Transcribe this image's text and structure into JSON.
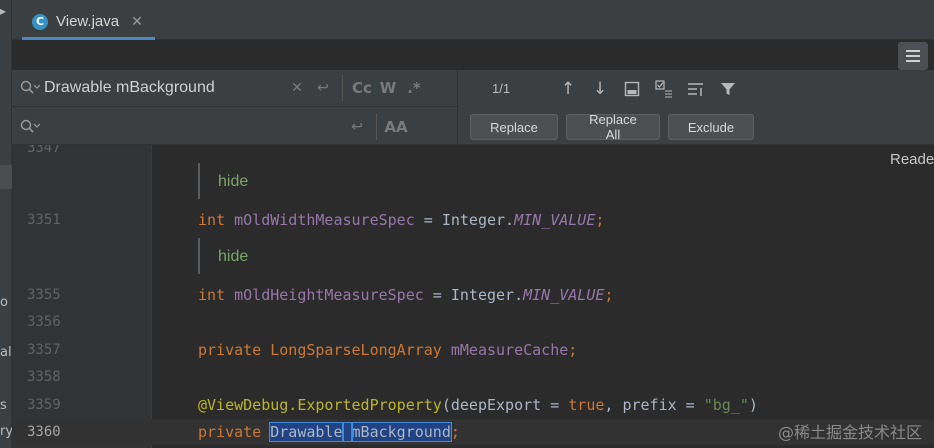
{
  "tab": {
    "title": "View.java",
    "icon_letter": "C",
    "close": "✕"
  },
  "left_strip_fragments": [
    "o",
    "al",
    "s",
    "ry"
  ],
  "find": {
    "query": "Drawable mBackground",
    "replace_value": "",
    "match_count": "1/1",
    "option_labels": {
      "match_case": "Cc",
      "words": "W",
      "regex": ".*",
      "preserve_case": "AA"
    }
  },
  "buttons": {
    "replace": "Replace",
    "replace_all": "Replace All",
    "exclude": "Exclude"
  },
  "reader_mode": "Reade",
  "watermark": "@稀土掘金技术社区",
  "editor": {
    "lines": [
      {
        "num": "3347"
      },
      {
        "doc": "hide"
      },
      {
        "num": "3351",
        "tokens": [
          [
            "int ",
            "kw"
          ],
          [
            "mOldWidthMeasureSpec",
            "fld"
          ],
          [
            " = Integer.",
            "plain"
          ],
          [
            "MIN_VALUE",
            "stat"
          ],
          [
            ";",
            "kw"
          ]
        ]
      },
      {
        "doc": "hide"
      },
      {
        "num": "3355",
        "tokens": [
          [
            "int ",
            "kw"
          ],
          [
            "mOldHeightMeasureSpec",
            "fld"
          ],
          [
            " = Integer.",
            "plain"
          ],
          [
            "MIN_VALUE",
            "stat"
          ],
          [
            ";",
            "kw"
          ]
        ]
      },
      {
        "num": "3356"
      },
      {
        "num": "3357",
        "tokens": [
          [
            "private ",
            "kw"
          ],
          [
            "LongSparseLongArray ",
            "kw"
          ],
          [
            "mMeasureCache",
            "fld"
          ],
          [
            ";",
            "kw"
          ]
        ]
      },
      {
        "num": "3358"
      },
      {
        "num": "3359",
        "tokens": [
          [
            "@ViewDebug.",
            "ann"
          ],
          [
            "ExportedProperty",
            "ann"
          ],
          [
            "(deepExport = ",
            "plain"
          ],
          [
            "true",
            "kw"
          ],
          [
            ", prefix = ",
            "plain"
          ],
          [
            "\"bg_\"",
            "str"
          ],
          [
            ")",
            "plain"
          ]
        ]
      },
      {
        "num": "3360",
        "tokens": [
          [
            "private ",
            "kw"
          ],
          [
            "Drawable",
            "sel"
          ],
          [
            " ",
            "sel"
          ],
          [
            "mBackground",
            "sel"
          ],
          [
            ";",
            "kw"
          ]
        ],
        "current": true
      }
    ]
  }
}
